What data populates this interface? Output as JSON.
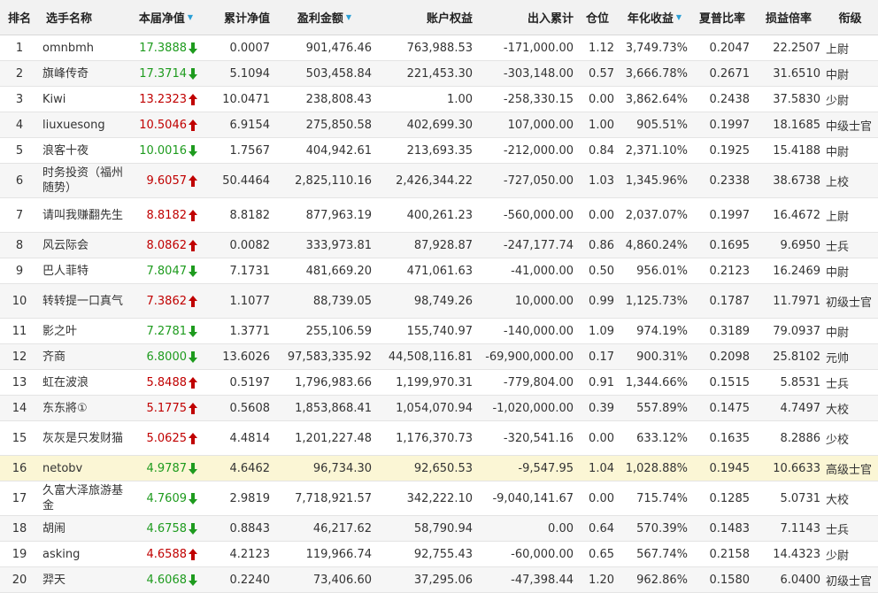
{
  "colors": {
    "up": "#c00000",
    "down": "#1e9b1e",
    "highlight_row": "#fbf6d5",
    "sort_arrow": "#2a9fd6"
  },
  "headers": {
    "rank": "排名",
    "name": "选手名称",
    "nav": "本届净值",
    "cum_nav": "累计净值",
    "profit": "盈利金额",
    "equity": "账户权益",
    "inout": "出入累计",
    "position": "仓位",
    "annual": "年化收益",
    "sharpe": "夏普比率",
    "pl_ratio": "损益倍率",
    "title": "衔级"
  },
  "rows": [
    {
      "rank": "1",
      "name": "omnbmh",
      "nav": "17.3888",
      "dir": "down",
      "cum": "0.0007",
      "profit": "901,476.46",
      "equity": "763,988.53",
      "inout": "-171,000.00",
      "pos": "1.12",
      "annual": "3,749.73%",
      "sharpe": "0.2047",
      "pl": "22.2507",
      "title": "上尉"
    },
    {
      "rank": "2",
      "name": "旗峰传奇",
      "nav": "17.3714",
      "dir": "down",
      "cum": "5.1094",
      "profit": "503,458.84",
      "equity": "221,453.30",
      "inout": "-303,148.00",
      "pos": "0.57",
      "annual": "3,666.78%",
      "sharpe": "0.2671",
      "pl": "31.6510",
      "title": "中尉"
    },
    {
      "rank": "3",
      "name": "Kiwi",
      "nav": "13.2323",
      "dir": "up",
      "cum": "10.0471",
      "profit": "238,808.43",
      "equity": "1.00",
      "inout": "-258,330.15",
      "pos": "0.00",
      "annual": "3,862.64%",
      "sharpe": "0.2438",
      "pl": "37.5830",
      "title": "少尉"
    },
    {
      "rank": "4",
      "name": "liuxuesong",
      "nav": "10.5046",
      "dir": "up",
      "cum": "6.9154",
      "profit": "275,850.58",
      "equity": "402,699.30",
      "inout": "107,000.00",
      "pos": "1.00",
      "annual": "905.51%",
      "sharpe": "0.1997",
      "pl": "18.1685",
      "title": "中级士官"
    },
    {
      "rank": "5",
      "name": "浪客十夜",
      "nav": "10.0016",
      "dir": "down",
      "cum": "1.7567",
      "profit": "404,942.61",
      "equity": "213,693.35",
      "inout": "-212,000.00",
      "pos": "0.84",
      "annual": "2,371.10%",
      "sharpe": "0.1925",
      "pl": "15.4188",
      "title": "中尉"
    },
    {
      "rank": "6",
      "name": "时务投资（福州随势）",
      "nav": "9.6057",
      "dir": "up",
      "cum": "50.4464",
      "profit": "2,825,110.16",
      "equity": "2,426,344.22",
      "inout": "-727,050.00",
      "pos": "1.03",
      "annual": "1,345.96%",
      "sharpe": "0.2338",
      "pl": "38.6738",
      "title": "上校"
    },
    {
      "rank": "7",
      "name": "请叫我赚翻先生",
      "nav": "8.8182",
      "dir": "up",
      "cum": "8.8182",
      "profit": "877,963.19",
      "equity": "400,261.23",
      "inout": "-560,000.00",
      "pos": "0.00",
      "annual": "2,037.07%",
      "sharpe": "0.1997",
      "pl": "16.4672",
      "title": "上尉"
    },
    {
      "rank": "8",
      "name": "风云际会",
      "nav": "8.0862",
      "dir": "up",
      "cum": "0.0082",
      "profit": "333,973.81",
      "equity": "87,928.87",
      "inout": "-247,177.74",
      "pos": "0.86",
      "annual": "4,860.24%",
      "sharpe": "0.1695",
      "pl": "9.6950",
      "title": "士兵"
    },
    {
      "rank": "9",
      "name": "巴人菲特",
      "nav": "7.8047",
      "dir": "down",
      "cum": "7.1731",
      "profit": "481,669.20",
      "equity": "471,061.63",
      "inout": "-41,000.00",
      "pos": "0.50",
      "annual": "956.01%",
      "sharpe": "0.2123",
      "pl": "16.2469",
      "title": "中尉"
    },
    {
      "rank": "10",
      "name": "转转提一口真气",
      "nav": "7.3862",
      "dir": "up",
      "cum": "1.1077",
      "profit": "88,739.05",
      "equity": "98,749.26",
      "inout": "10,000.00",
      "pos": "0.99",
      "annual": "1,125.73%",
      "sharpe": "0.1787",
      "pl": "11.7971",
      "title": "初级士官"
    },
    {
      "rank": "11",
      "name": "影之叶",
      "nav": "7.2781",
      "dir": "down",
      "cum": "1.3771",
      "profit": "255,106.59",
      "equity": "155,740.97",
      "inout": "-140,000.00",
      "pos": "1.09",
      "annual": "974.19%",
      "sharpe": "0.3189",
      "pl": "79.0937",
      "title": "中尉"
    },
    {
      "rank": "12",
      "name": "齐商",
      "nav": "6.8000",
      "dir": "down",
      "cum": "13.6026",
      "profit": "97,583,335.92",
      "equity": "44,508,116.81",
      "inout": "-69,900,000.00",
      "pos": "0.17",
      "annual": "900.31%",
      "sharpe": "0.2098",
      "pl": "25.8102",
      "title": "元帅"
    },
    {
      "rank": "13",
      "name": "虹在波浪",
      "nav": "5.8488",
      "dir": "up",
      "cum": "0.5197",
      "profit": "1,796,983.66",
      "equity": "1,199,970.31",
      "inout": "-779,804.00",
      "pos": "0.91",
      "annual": "1,344.66%",
      "sharpe": "0.1515",
      "pl": "5.8531",
      "title": "士兵"
    },
    {
      "rank": "14",
      "name": "东东將①",
      "nav": "5.1775",
      "dir": "up",
      "cum": "0.5608",
      "profit": "1,853,868.41",
      "equity": "1,054,070.94",
      "inout": "-1,020,000.00",
      "pos": "0.39",
      "annual": "557.89%",
      "sharpe": "0.1475",
      "pl": "4.7497",
      "title": "大校"
    },
    {
      "rank": "15",
      "name": "灰灰是只发财猫",
      "nav": "5.0625",
      "dir": "up",
      "cum": "4.4814",
      "profit": "1,201,227.48",
      "equity": "1,176,370.73",
      "inout": "-320,541.16",
      "pos": "0.00",
      "annual": "633.12%",
      "sharpe": "0.1635",
      "pl": "8.2886",
      "title": "少校"
    },
    {
      "rank": "16",
      "name": "netobv",
      "nav": "4.9787",
      "dir": "down",
      "cum": "4.6462",
      "profit": "96,734.30",
      "equity": "92,650.53",
      "inout": "-9,547.95",
      "pos": "1.04",
      "annual": "1,028.88%",
      "sharpe": "0.1945",
      "pl": "10.6633",
      "title": "高级士官"
    },
    {
      "rank": "17",
      "name": "久富大泽旅游基金",
      "nav": "4.7609",
      "dir": "down",
      "cum": "2.9819",
      "profit": "7,718,921.57",
      "equity": "342,222.10",
      "inout": "-9,040,141.67",
      "pos": "0.00",
      "annual": "715.74%",
      "sharpe": "0.1285",
      "pl": "5.0731",
      "title": "大校"
    },
    {
      "rank": "18",
      "name": "胡闹",
      "nav": "4.6758",
      "dir": "down",
      "cum": "0.8843",
      "profit": "46,217.62",
      "equity": "58,790.94",
      "inout": "0.00",
      "pos": "0.64",
      "annual": "570.39%",
      "sharpe": "0.1483",
      "pl": "7.1143",
      "title": "士兵"
    },
    {
      "rank": "19",
      "name": "asking",
      "nav": "4.6588",
      "dir": "up",
      "cum": "4.2123",
      "profit": "119,966.74",
      "equity": "92,755.43",
      "inout": "-60,000.00",
      "pos": "0.65",
      "annual": "567.74%",
      "sharpe": "0.2158",
      "pl": "14.4323",
      "title": "少尉"
    },
    {
      "rank": "20",
      "name": "羿天",
      "nav": "4.6068",
      "dir": "down",
      "cum": "0.2240",
      "profit": "73,406.60",
      "equity": "37,295.06",
      "inout": "-47,398.44",
      "pos": "1.20",
      "annual": "962.86%",
      "sharpe": "0.1580",
      "pl": "6.0400",
      "title": "初级士官"
    }
  ]
}
